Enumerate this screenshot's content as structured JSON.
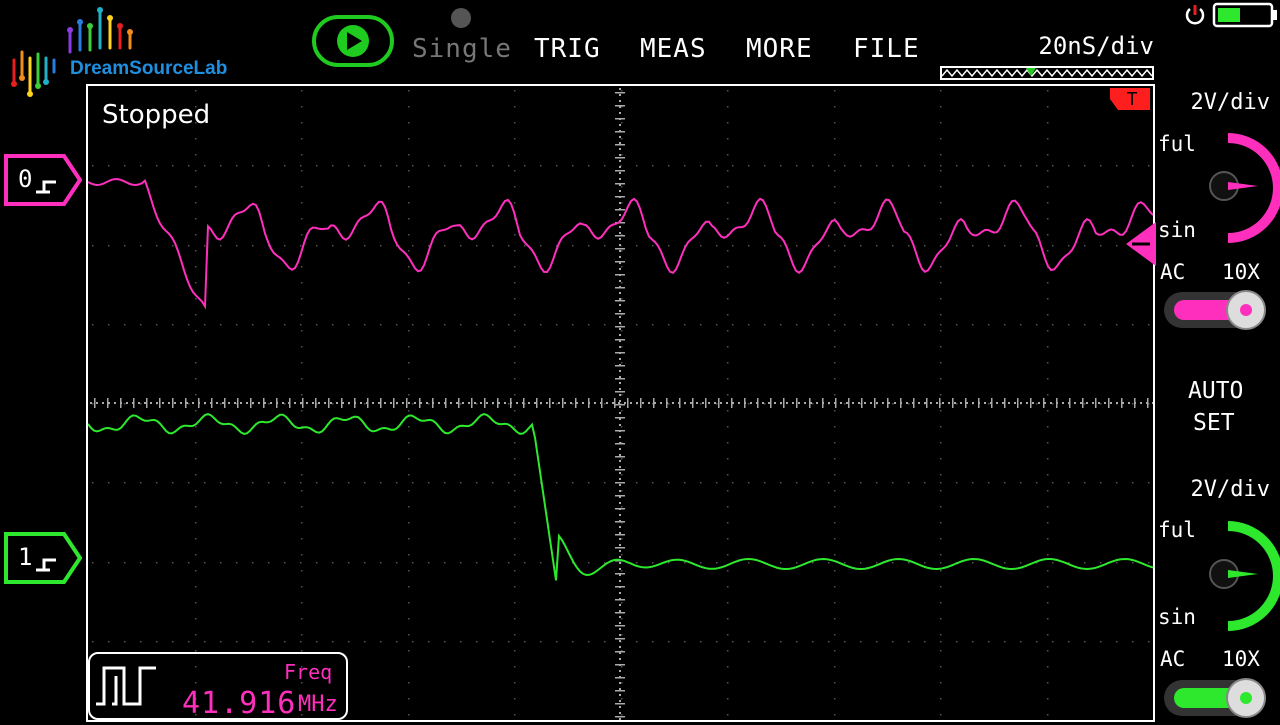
{
  "brand": {
    "logo_text": "DreamSourceLab"
  },
  "menu": {
    "single_label": "Single",
    "trig_label": "TRIG",
    "meas_label": "MEAS",
    "more_label": "MORE",
    "file_label": "FILE"
  },
  "timebase": "20nS/div",
  "status": "Stopped",
  "channels": [
    {
      "id": "0",
      "color": "#ff2fbd",
      "vdiv": "2V/div",
      "bw_top": "ful",
      "bw_bottom": "sin",
      "coupling": "AC",
      "probe": "10X"
    },
    {
      "id": "1",
      "color": "#2ee82e",
      "vdiv": "2V/div",
      "bw_top": "ful",
      "bw_bottom": "sin",
      "coupling": "AC",
      "probe": "10X"
    }
  ],
  "autoset": {
    "line1": "AUTO",
    "line2": "SET"
  },
  "trigger_marker": "T",
  "measurement": {
    "label": "Freq",
    "value": "41.916",
    "unit": "MHz"
  },
  "icons": {
    "play": "play-icon",
    "power": "power-icon",
    "battery": "battery-icon",
    "square_wave": "square-wave-icon"
  }
}
